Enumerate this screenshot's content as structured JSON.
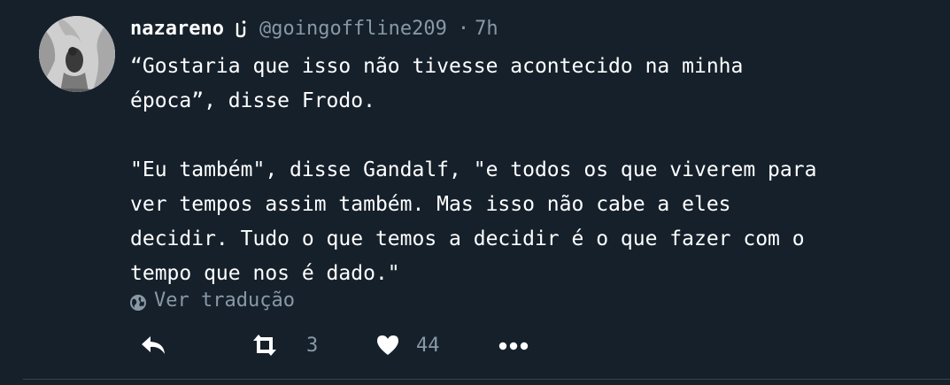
{
  "tweet": {
    "display_name": "nazareno",
    "handle": "@goingoffline209",
    "separator": "·",
    "time": "7h",
    "text": "“Gostaria que isso não tivesse acontecido na minha\népoca”, disse Frodo.\n\n\"Eu também\", disse Gandalf, \"e todos os que viverem para\nver tempos assim também. Mas isso não cabe a eles\ndecidir. Tudo o que temos a decidir é o que fazer com o\ntempo que nos é dado.\"",
    "translate_label": "Ver tradução"
  },
  "actions": {
    "reply_icon": "reply-icon",
    "retweet_icon": "retweet-icon",
    "retweet_count": "3",
    "like_icon": "heart-icon",
    "like_count": "44",
    "more_icon": "more-icon"
  },
  "colors": {
    "background": "#15202b",
    "text": "#ffffff",
    "secondary_text": "#8899a6",
    "divider": "#38444d"
  }
}
